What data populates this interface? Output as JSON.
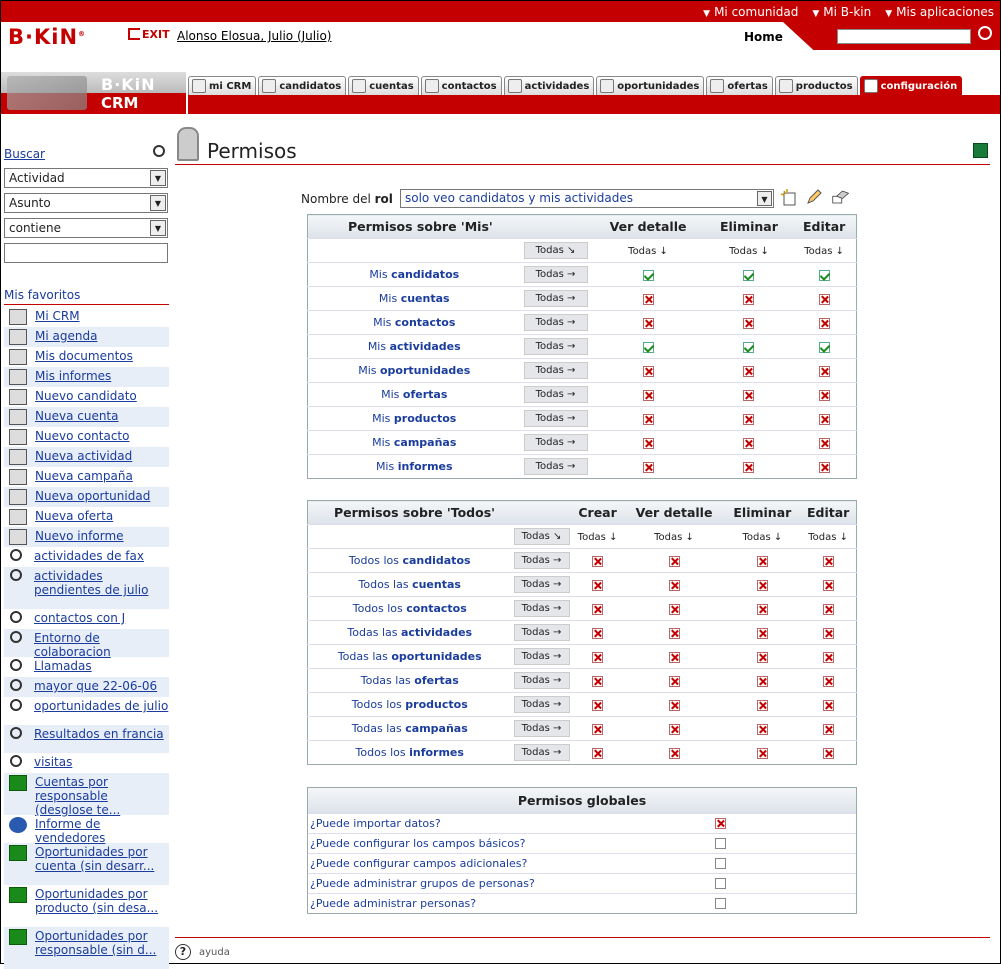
{
  "topbar": {
    "links": [
      "Mi comunidad",
      "Mi B-kin",
      "Mis aplicaciones"
    ]
  },
  "header": {
    "logo": "B·KiN",
    "exit": "EXIT",
    "user": "Alonso Elosua, Julio (Julio)",
    "home": "Home",
    "search_value": ""
  },
  "crm": {
    "brand": "B·KiN",
    "label": "CRM"
  },
  "tabs": [
    "mi CRM",
    "candidatos",
    "cuentas",
    "contactos",
    "actividades",
    "oportunidades",
    "ofertas",
    "productos",
    "configuración"
  ],
  "sidebar": {
    "buscar": "Buscar",
    "selects": [
      "Actividad",
      "Asunto",
      "contiene"
    ],
    "favoritos_title": "Mis favoritos",
    "items": [
      {
        "label": "Mi CRM",
        "icon": "monitor-icon"
      },
      {
        "label": "Mi agenda",
        "icon": "calendar-icon"
      },
      {
        "label": "Mis documentos",
        "icon": "documents-icon"
      },
      {
        "label": "Mis informes",
        "icon": "report-chart-icon"
      },
      {
        "label": "Nuevo candidato",
        "icon": "new-candidate-icon"
      },
      {
        "label": "Nueva cuenta",
        "icon": "new-account-icon"
      },
      {
        "label": "Nuevo contacto",
        "icon": "new-contact-icon"
      },
      {
        "label": "Nueva actividad",
        "icon": "new-activity-icon"
      },
      {
        "label": "Nueva campaña",
        "icon": "new-campaign-icon"
      },
      {
        "label": "Nueva oportunidad",
        "icon": "new-opportunity-icon"
      },
      {
        "label": "Nueva oferta",
        "icon": "new-offer-icon"
      },
      {
        "label": "Nuevo informe",
        "icon": "new-report-icon"
      },
      {
        "label": "actividades de fax",
        "icon": "search-icon"
      },
      {
        "label": "actividades pendientes de julio",
        "icon": "search-icon"
      },
      {
        "label": "contactos con J",
        "icon": "search-icon"
      },
      {
        "label": "Entorno de colaboracion",
        "icon": "search-icon"
      },
      {
        "label": "Llamadas",
        "icon": "search-icon"
      },
      {
        "label": "mayor que 22-06-06",
        "icon": "search-icon"
      },
      {
        "label": "oportunidades de julio",
        "icon": "search-icon"
      },
      {
        "label": "Resultados en francia",
        "icon": "search-icon"
      },
      {
        "label": "visitas",
        "icon": "search-icon"
      },
      {
        "label": "Cuentas por responsable (desglose te...",
        "icon": "excel-icon"
      },
      {
        "label": "Informe de vendedores",
        "icon": "globe-icon"
      },
      {
        "label": "Oportunidades por cuenta (sin desarr...",
        "icon": "excel-icon"
      },
      {
        "label": "Oportunidades por producto (sin desa...",
        "icon": "excel-icon"
      },
      {
        "label": "Oportunidades por responsable (sin d...",
        "icon": "excel-icon"
      }
    ]
  },
  "main": {
    "title": "Permisos",
    "role_label_prefix": "Nombre del ",
    "role_label_bold": "rol",
    "role_value": "solo veo candidatos y mis actividades",
    "todas": "Todas",
    "mis": {
      "header": "Permisos sobre 'Mis'",
      "columns": [
        "Ver detalle",
        "Eliminar",
        "Editar"
      ],
      "rows": [
        {
          "pre": "Mis ",
          "name": "candidatos",
          "vals": [
            "ok",
            "ok",
            "ok"
          ]
        },
        {
          "pre": "Mis ",
          "name": "cuentas",
          "vals": [
            "no",
            "no",
            "no"
          ]
        },
        {
          "pre": "Mis ",
          "name": "contactos",
          "vals": [
            "no",
            "no",
            "no"
          ]
        },
        {
          "pre": "Mis ",
          "name": "actividades",
          "vals": [
            "ok",
            "ok",
            "ok"
          ]
        },
        {
          "pre": "Mis ",
          "name": "oportunidades",
          "vals": [
            "no",
            "no",
            "no"
          ]
        },
        {
          "pre": "Mis ",
          "name": "ofertas",
          "vals": [
            "no",
            "no",
            "no"
          ]
        },
        {
          "pre": "Mis ",
          "name": "productos",
          "vals": [
            "no",
            "no",
            "no"
          ]
        },
        {
          "pre": "Mis ",
          "name": "campañas",
          "vals": [
            "no",
            "no",
            "no"
          ]
        },
        {
          "pre": "Mis ",
          "name": "informes",
          "vals": [
            "no",
            "no",
            "no"
          ]
        }
      ]
    },
    "todos": {
      "header": "Permisos sobre 'Todos'",
      "columns": [
        "Crear",
        "Ver detalle",
        "Eliminar",
        "Editar"
      ],
      "rows": [
        {
          "pre": "Todos los ",
          "name": "candidatos"
        },
        {
          "pre": "Todos las ",
          "name": "cuentas"
        },
        {
          "pre": "Todos los ",
          "name": "contactos"
        },
        {
          "pre": "Todas las ",
          "name": "actividades"
        },
        {
          "pre": "Todas las ",
          "name": "oportunidades"
        },
        {
          "pre": "Todas las ",
          "name": "ofertas"
        },
        {
          "pre": "Todos los ",
          "name": "productos"
        },
        {
          "pre": "Todas las ",
          "name": "campañas"
        },
        {
          "pre": "Todos los ",
          "name": "informes"
        }
      ]
    },
    "global": {
      "header": "Permisos globales",
      "rows": [
        {
          "label": "¿Puede importar datos?",
          "state": "no"
        },
        {
          "label": "¿Puede configurar los campos básicos?",
          "state": "empty"
        },
        {
          "label": "¿Puede configurar campos adicionales?",
          "state": "empty"
        },
        {
          "label": "¿Puede administrar grupos de personas?",
          "state": "empty"
        },
        {
          "label": "¿Puede administrar personas?",
          "state": "empty"
        }
      ]
    },
    "help": "ayuda"
  }
}
